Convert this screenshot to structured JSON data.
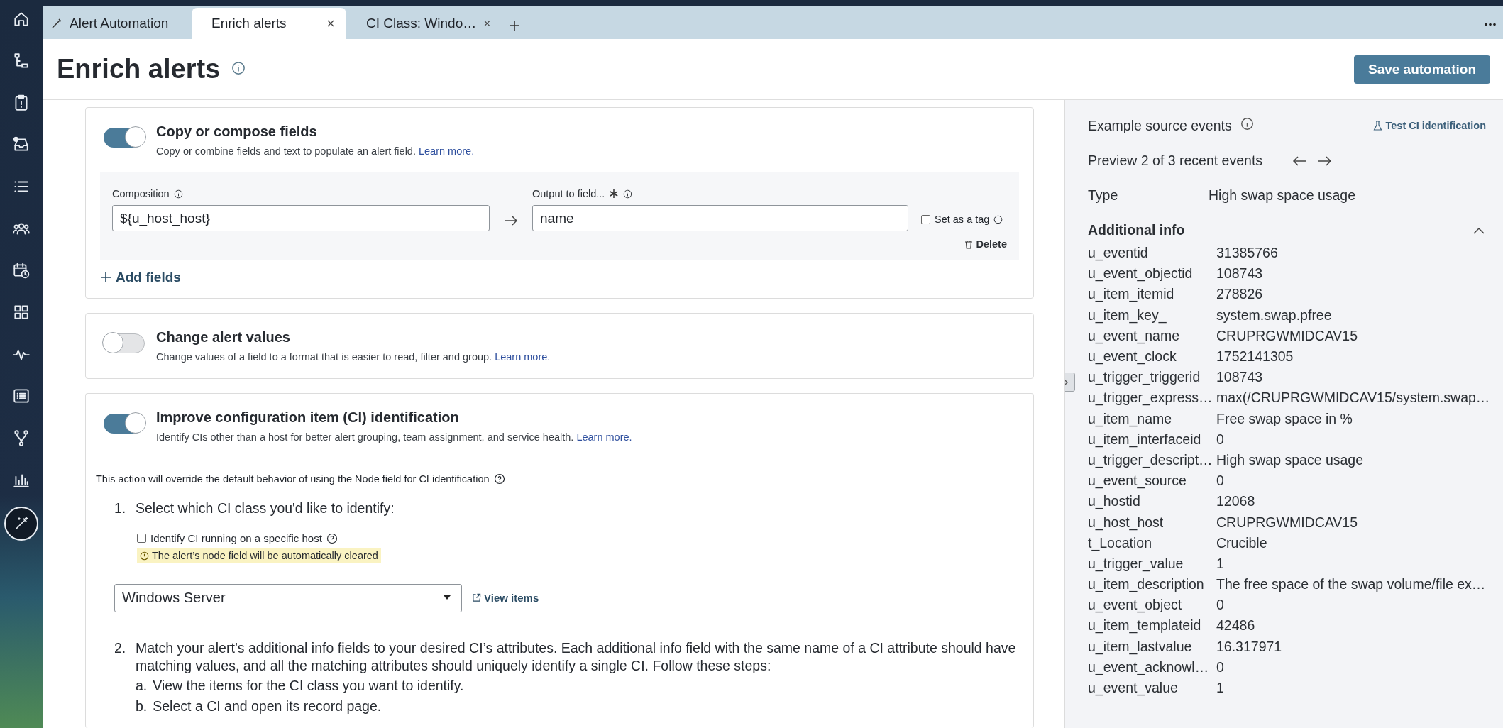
{
  "nav_rail": [
    {
      "kind": "home",
      "selected": false
    },
    {
      "kind": "hierarchy",
      "selected": false
    },
    {
      "kind": "clipboard",
      "selected": false
    },
    {
      "kind": "inbox",
      "selected": false
    },
    {
      "kind": "list",
      "selected": false
    },
    {
      "kind": "people",
      "selected": false
    },
    {
      "kind": "calendar",
      "selected": false
    },
    {
      "kind": "grid",
      "selected": false
    },
    {
      "kind": "pulse",
      "selected": false
    },
    {
      "kind": "listbox",
      "selected": false
    },
    {
      "kind": "fork",
      "selected": false
    },
    {
      "kind": "bars",
      "selected": false
    },
    {
      "kind": "wand",
      "selected": true
    }
  ],
  "tabs": [
    {
      "label": "Alert Automation",
      "kind": "pinned",
      "selected": false
    },
    {
      "label": "Enrich alerts",
      "kind": "closable",
      "selected": true
    },
    {
      "label": "CI Class: Windo…",
      "kind": "closable",
      "selected": false
    }
  ],
  "page": {
    "title": "Enrich alerts",
    "save_button": "Save automation"
  },
  "copy_compose": {
    "on": true,
    "heading": "Copy or compose fields",
    "description": "Copy or combine fields and text to populate an alert field.",
    "link": "Learn more.",
    "composition_label": "Composition",
    "composition_value": "${u_host_host}",
    "output_label": "Output to field...",
    "output_value": "name",
    "tag_label": "Set as a tag",
    "tag_checked": false,
    "delete": "Delete",
    "add_fields": "Add fields"
  },
  "change_values": {
    "on": false,
    "heading": "Change alert values",
    "description": "Change values of a field to a format that is easier to read, filter and group.",
    "link": "Learn more."
  },
  "ci_identification": {
    "on": true,
    "heading": "Improve configuration item (CI) identification",
    "description": "Identify CIs other than a host for better alert grouping, team assignment, and service health.",
    "link": "Learn more.",
    "note": "This action will override the default behavior of using the Node field for CI identification",
    "step1_number": "1.",
    "step1": "Select which CI class you'd like to identify:",
    "host_label": "Identify CI running on a specific host",
    "host_checked": false,
    "warning": "The alert’s node field will be automatically cleared",
    "ci_class": "Windows Server",
    "view_items": "View items",
    "step2_number": "2.",
    "step2": "Match your alert’s additional info fields to your desired CI’s attributes. Each additional info field with the same name of a CI attribute should have matching values, and all the matching attributes should uniquely identify a single CI. Follow these steps:",
    "substeps": [
      {
        "letter": "a.",
        "text": "View the items for the CI class you want to identify."
      },
      {
        "letter": "b.",
        "text": "Select a CI and open its record page."
      }
    ]
  },
  "source_events": {
    "title": "Example source events",
    "test_link": "Test CI identification",
    "preview": "Preview 2 of 3 recent events",
    "type_label": "Type",
    "type_value": "High swap space usage",
    "additional_info": {
      "heading": "Additional info",
      "expanded": true,
      "rows": [
        {
          "key": "u_eventid",
          "value": "31385766"
        },
        {
          "key": "u_event_objectid",
          "value": "108743"
        },
        {
          "key": "u_item_itemid",
          "value": "278826"
        },
        {
          "key": "u_item_key_",
          "value": "system.swap.pfree"
        },
        {
          "key": "u_event_name",
          "value": "CRUPRGWMIDCAV15"
        },
        {
          "key": "u_event_clock",
          "value": "1752141305"
        },
        {
          "key": "u_trigger_triggerid",
          "value": "108743"
        },
        {
          "key": "u_trigger_express…",
          "value": "max(/CRUPRGWMIDCAV15/system.swap…"
        },
        {
          "key": "u_item_name",
          "value": "Free swap space in %"
        },
        {
          "key": "u_item_interfaceid",
          "value": "0"
        },
        {
          "key": "u_trigger_descript…",
          "value": "High swap space usage"
        },
        {
          "key": "u_event_source",
          "value": "0"
        },
        {
          "key": "u_hostid",
          "value": "12068"
        },
        {
          "key": "u_host_host",
          "value": "CRUPRGWMIDCAV15"
        },
        {
          "key": "t_Location",
          "value": "Crucible"
        },
        {
          "key": "u_trigger_value",
          "value": "1"
        },
        {
          "key": "u_item_description",
          "value": "The free space of the swap volume/file ex…"
        },
        {
          "key": "u_event_object",
          "value": "0"
        },
        {
          "key": "u_item_templateid",
          "value": "42486"
        },
        {
          "key": "u_item_lastvalue",
          "value": "16.317971"
        },
        {
          "key": "u_event_acknowl…",
          "value": "0"
        },
        {
          "key": "u_event_value",
          "value": "1"
        }
      ]
    }
  }
}
